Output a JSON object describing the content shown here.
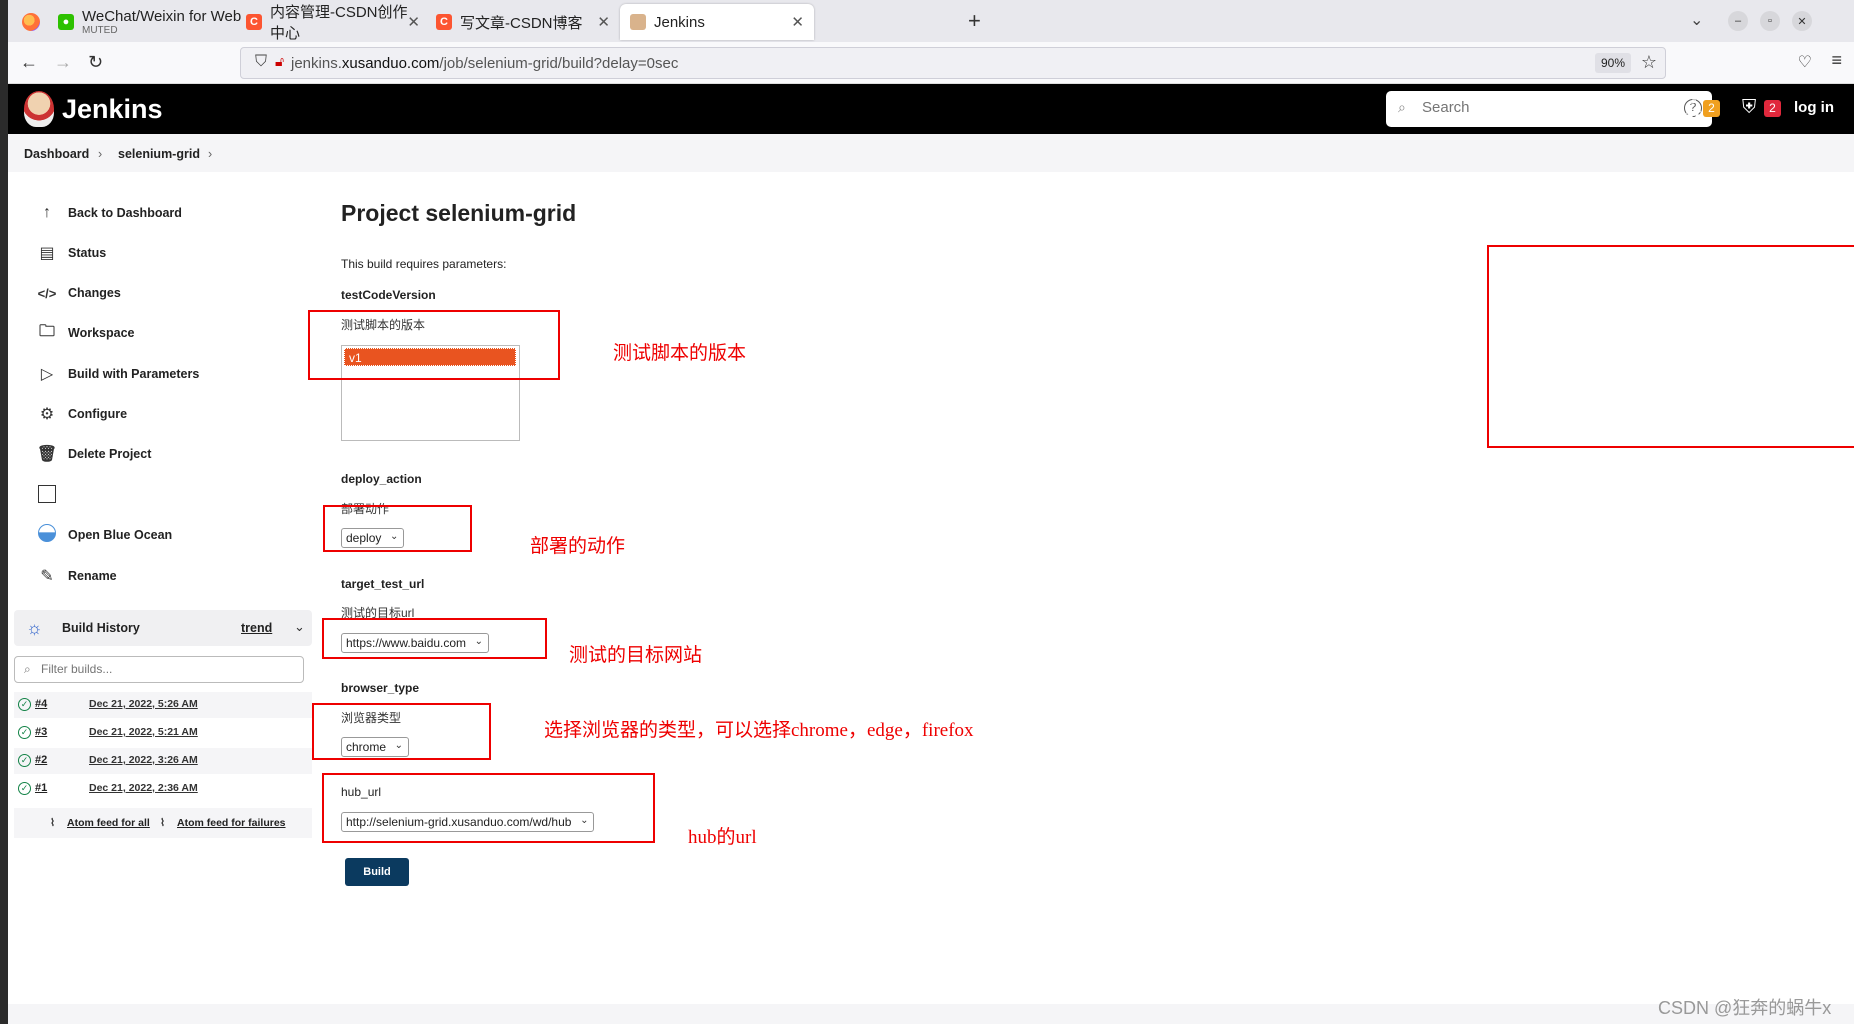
{
  "browser": {
    "tabs": [
      {
        "title": "WeChat/Weixin for Web",
        "subtitle": "MUTED"
      },
      {
        "title": "内容管理-CSDN创作中心"
      },
      {
        "title": "写文章-CSDN博客"
      },
      {
        "title": "Jenkins"
      }
    ],
    "url_prefix": "jenkins.",
    "url_domain": "xusanduo.com",
    "url_path": "/job/selenium-grid/build?delay=0sec",
    "zoom": "90%"
  },
  "header": {
    "title": "Jenkins",
    "search_placeholder": "Search",
    "notifications_count": "2",
    "security_count": "2",
    "login": "log in"
  },
  "breadcrumb": [
    "Dashboard",
    "selenium-grid"
  ],
  "sidebar": {
    "items": [
      {
        "label": "Back to Dashboard",
        "icon": "arrow-up-icon"
      },
      {
        "label": "Status",
        "icon": "document-icon"
      },
      {
        "label": "Changes",
        "icon": "code-icon"
      },
      {
        "label": "Workspace",
        "icon": "folder-icon"
      },
      {
        "label": "Build with Parameters",
        "icon": "play-icon"
      },
      {
        "label": "Configure",
        "icon": "gear-icon"
      },
      {
        "label": "Delete Project",
        "icon": "trash-icon"
      },
      {
        "label": "Open Blue Ocean",
        "icon": "blue-ocean-icon"
      },
      {
        "label": "Rename",
        "icon": "pencil-icon"
      }
    ],
    "build_history": {
      "title": "Build History",
      "trend": "trend",
      "filter_placeholder": "Filter builds...",
      "builds": [
        {
          "num": "#4",
          "date": "Dec 21, 2022, 5:26 AM"
        },
        {
          "num": "#3",
          "date": "Dec 21, 2022, 5:21 AM"
        },
        {
          "num": "#2",
          "date": "Dec 21, 2022, 3:26 AM"
        },
        {
          "num": "#1",
          "date": "Dec 21, 2022, 2:36 AM"
        }
      ],
      "feed_all": "Atom feed for all",
      "feed_failures": "Atom feed for failures"
    }
  },
  "main": {
    "title": "Project selenium-grid",
    "requires": "This build requires parameters:",
    "params": {
      "testCodeVersion": {
        "name": "testCodeVersion",
        "desc": "测试脚本的版本",
        "options": [
          "v1"
        ],
        "selected": "v1"
      },
      "deploy_action": {
        "name": "deploy_action",
        "desc": "部署动作",
        "value": "deploy"
      },
      "target_test_url": {
        "name": "target_test_url",
        "desc": "测试的目标url",
        "value": "https://www.baidu.com"
      },
      "browser_type": {
        "name": "browser_type",
        "desc": "浏览器类型",
        "value": "chrome"
      },
      "hub_url": {
        "name": "hub_url",
        "value": "http://selenium-grid.xusanduo.com/wd/hub"
      }
    },
    "build_button": "Build"
  },
  "annotations": {
    "a1": "测试脚本的版本",
    "a2": "部署的动作",
    "a3": "测试的目标网站",
    "a4": "选择浏览器的类型，可以选择chrome，edge，firefox",
    "a5": "hub的url"
  },
  "watermark": "CSDN @狂奔的蜗牛x",
  "colors": {
    "jenkins_header": "#000000",
    "accent_orange": "#e95420",
    "build_button": "#0b3a5f",
    "annotation_red": "#e00000",
    "success_green": "#138347"
  }
}
